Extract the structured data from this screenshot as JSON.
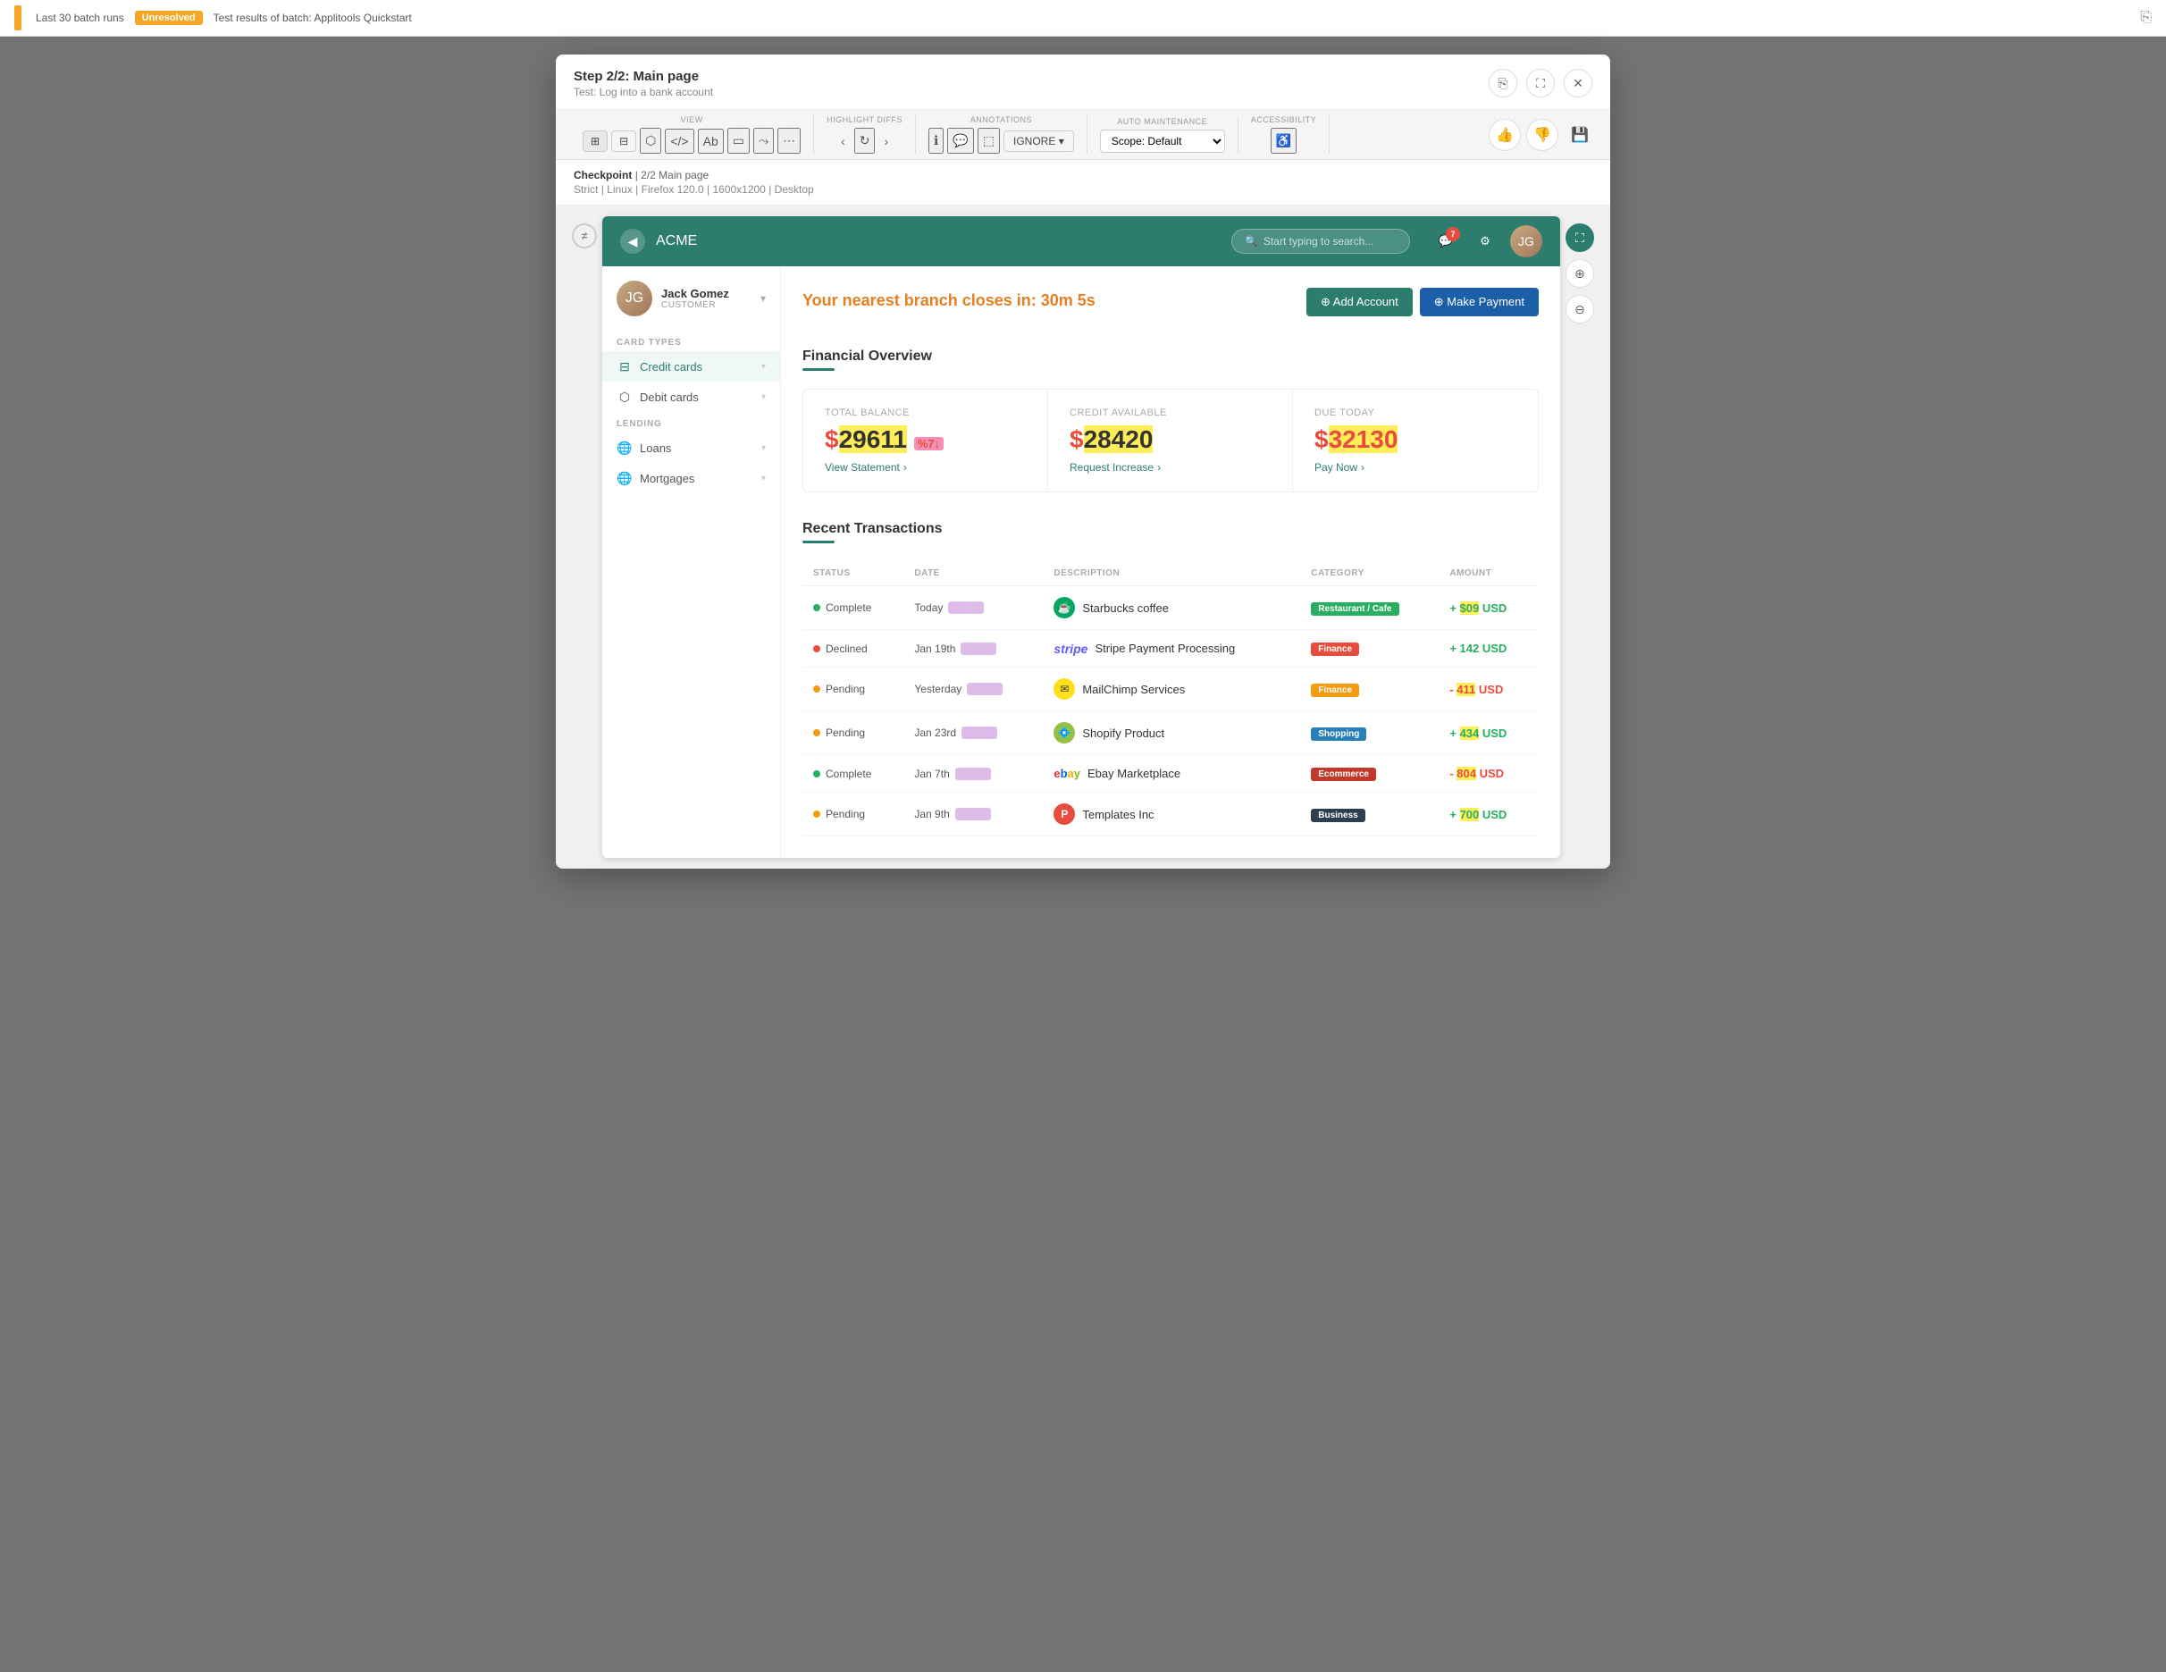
{
  "topBar": {
    "batchLabel": "Last 30 batch runs",
    "unresolvedLabel": "Unresolved",
    "batchTitle": "Test results of batch: Applitools Quickstart",
    "shareIcon": "⎘"
  },
  "modal": {
    "step": "Step 2/2: Main page",
    "subtitle": "Test: Log into a bank account",
    "shareLabel": "⎘",
    "expandLabel": "⛶",
    "closeLabel": "✕"
  },
  "toolbar": {
    "sections": [
      {
        "label": "VIEW",
        "controls": [
          "grid-icon",
          "layout-icon",
          "layers-icon",
          "code-icon",
          "ab-icon",
          "crop-icon",
          "share-icon",
          "more-icon"
        ]
      },
      {
        "label": "HIGHLIGHT DIFFS",
        "controls": [
          "arrow-left",
          "refresh-icon",
          "arrow-right"
        ]
      },
      {
        "label": "ANNOTATIONS",
        "controls": [
          "info-icon",
          "comment-icon",
          "selection-icon",
          "ignore-label"
        ]
      },
      {
        "label": "AUTO MAINTENANCE",
        "controls": [
          "scope-select"
        ]
      },
      {
        "label": "ACCESSIBILITY",
        "controls": [
          "person-icon"
        ]
      }
    ],
    "scopeDefault": "Scope: Default",
    "ignoreLabel": "IGNORE",
    "thumbUpLabel": "👍",
    "thumbDownLabel": "👎",
    "saveLabel": "💾"
  },
  "checkpoint": {
    "label": "Checkpoint",
    "step": "2/2 Main page",
    "strict": "Strict",
    "os": "Linux",
    "browser": "Firefox 120.0",
    "resolution": "1600x1200",
    "type": "Desktop"
  },
  "app": {
    "nav": {
      "logoText": "ACME",
      "searchPlaceholder": "Start typing to search...",
      "notificationCount": "7"
    },
    "user": {
      "name": "Jack Gomez",
      "role": "CUSTOMER",
      "initials": "JG"
    },
    "sidebar": {
      "cardTypesLabel": "CARD TYPES",
      "lendingLabel": "LENDING",
      "items": [
        {
          "id": "credit-cards",
          "label": "Credit cards",
          "icon": "💳",
          "hasArrow": true
        },
        {
          "id": "debit-cards",
          "label": "Debit cards",
          "icon": "🏦",
          "hasArrow": true
        },
        {
          "id": "loans",
          "label": "Loans",
          "icon": "🌐",
          "hasArrow": true
        },
        {
          "id": "mortgages",
          "label": "Mortgages",
          "icon": "🌐",
          "hasArrow": true
        }
      ]
    },
    "overview": {
      "title": "Financial Overview",
      "alertText": "Your nearest branch closes in: 30m 5s",
      "addAccountBtn": "⊕ Add Account",
      "makePaymentBtn": "⊕ Make Payment",
      "cards": [
        {
          "label": "Total Balance",
          "amount": "$29611",
          "badge": "%7↓",
          "linkText": "View Statement",
          "linkIcon": "›"
        },
        {
          "label": "Credit Available",
          "amount": "$28420",
          "badge": "",
          "linkText": "Request Increase",
          "linkIcon": "›"
        },
        {
          "label": "Due Today",
          "amount": "$32130",
          "badge": "",
          "linkText": "Pay Now",
          "linkIcon": "›"
        }
      ]
    },
    "transactions": {
      "title": "Recent Transactions",
      "columns": [
        "STATUS",
        "DATE",
        "DESCRIPTION",
        "CATEGORY",
        "AMOUNT"
      ],
      "rows": [
        {
          "status": "Complete",
          "statusType": "complete",
          "date": "Today",
          "dateBlur": true,
          "merchant": "Starbucks coffee",
          "merchantIcon": "☕",
          "merchantIconBg": "#00a862",
          "category": "Restaurant / Cafe",
          "categoryClass": "cat-restaurant",
          "amount": "+ $09 USD",
          "amountType": "pos",
          "amountHighlight": "509"
        },
        {
          "status": "Declined",
          "statusType": "declined",
          "date": "Jan 19th",
          "dateBlur": true,
          "merchant": "Stripe Payment Processing",
          "merchantIcon": "stripe",
          "merchantIconBg": "#635bff",
          "category": "Finance",
          "categoryClass": "cat-finance",
          "amount": "+ 142 USD",
          "amountType": "pos",
          "amountHighlight": ""
        },
        {
          "status": "Pending",
          "statusType": "pending",
          "date": "Yesterday",
          "dateBlur": true,
          "merchant": "MailChimp Services",
          "merchantIcon": "✉",
          "merchantIconBg": "#ffe01b",
          "category": "Finance",
          "categoryClass": "cat-finance-yellow",
          "amount": "- 411 USD",
          "amountType": "neg",
          "amountHighlight": "411"
        },
        {
          "status": "Pending",
          "statusType": "pending",
          "date": "Jan 23rd",
          "dateBlur": true,
          "merchant": "Shopify Product",
          "merchantIcon": "💠",
          "merchantIconBg": "#96bf48",
          "category": "Shopping",
          "categoryClass": "cat-shopping",
          "amount": "+ 434 USD",
          "amountType": "pos",
          "amountHighlight": "434"
        },
        {
          "status": "Complete",
          "statusType": "complete",
          "date": "Jan 7th",
          "dateBlur": true,
          "merchant": "Ebay Marketplace",
          "merchantIcon": "ebay",
          "merchantIconBg": "#fff",
          "category": "Ecommerce",
          "categoryClass": "cat-ecommerce",
          "amount": "- 804 USD",
          "amountType": "neg",
          "amountHighlight": "804"
        },
        {
          "status": "Pending",
          "statusType": "pending",
          "date": "Jan 9th",
          "dateBlur": true,
          "merchant": "Templates Inc",
          "merchantIcon": "P",
          "merchantIconBg": "#e74c3c",
          "category": "Business",
          "categoryClass": "cat-business",
          "amount": "+ 700 USD",
          "amountType": "pos",
          "amountHighlight": "700"
        }
      ]
    }
  }
}
